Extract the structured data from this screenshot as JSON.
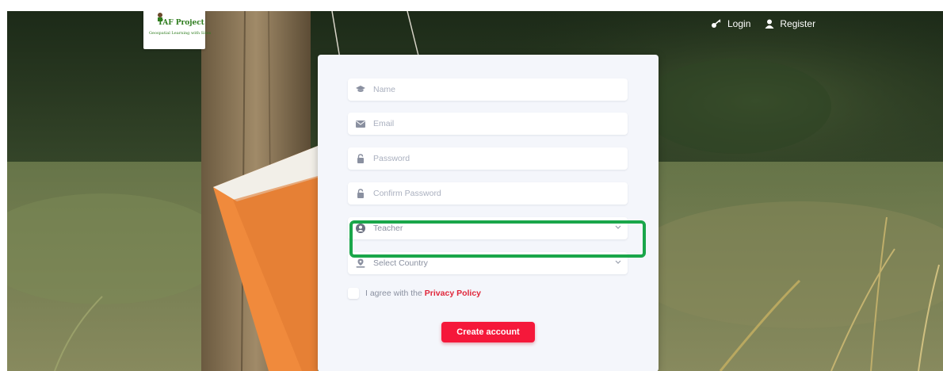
{
  "logo": {
    "title": "TAF Project",
    "subtitle": "Geospatial Learning with Sites"
  },
  "nav": {
    "login_label": "Login",
    "register_label": "Register"
  },
  "form": {
    "name_placeholder": "Name",
    "email_placeholder": "Email",
    "password_placeholder": "Password",
    "confirm_password_placeholder": "Confirm Password",
    "role_selected": "Teacher",
    "country_placeholder": "Select Country",
    "agree_text": "I agree with the",
    "privacy_policy_label": "Privacy Policy",
    "create_account_label": "Create account"
  },
  "icons": {
    "login": "login-key-icon",
    "register": "user-icon",
    "name": "graduation-cap-icon",
    "email": "envelope-icon",
    "password": "lock-icon",
    "confirm_password": "lock-icon",
    "role": "user-circle-icon",
    "country": "location-pin-icon",
    "dropdown": "chevron-down-icon"
  },
  "colors": {
    "accent": "#f5183a",
    "highlight": "#1aa64a",
    "card": "#f4f6fb",
    "nav_text": "#ffffff"
  }
}
